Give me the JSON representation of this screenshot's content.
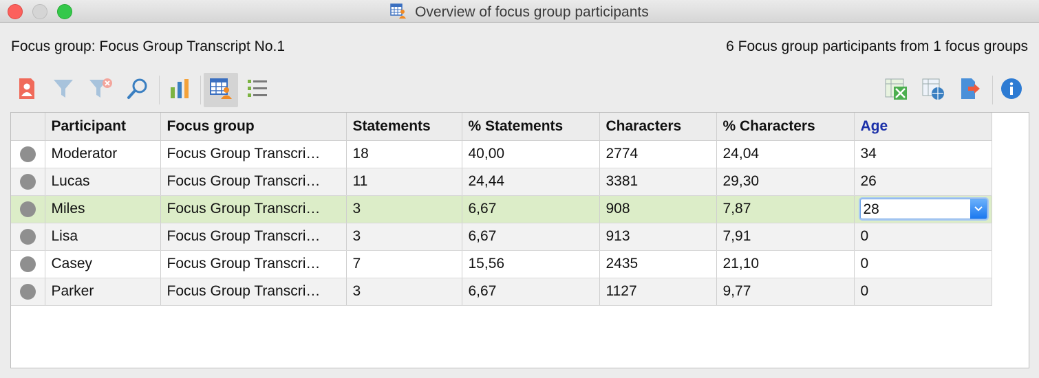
{
  "window": {
    "title": "Overview of focus group participants"
  },
  "info": {
    "focus_group": "Focus group: Focus Group Transcript No.1",
    "summary": "6 Focus group participants from 1 focus groups"
  },
  "toolbar": {
    "icons": [
      "participant-icon",
      "filter-icon",
      "remove-filter-icon",
      "search-icon",
      "bar-chart-icon",
      "participant-table-icon",
      "list-icon",
      "excel-export-icon",
      "html-export-icon",
      "export-icon",
      "info-icon"
    ]
  },
  "table": {
    "columns": [
      "Participant",
      "Focus group",
      "Statements",
      "% Statements",
      "Characters",
      "% Characters",
      "Age"
    ],
    "rows": [
      {
        "participant": "Moderator",
        "group": "Focus Group Transcri…",
        "statements": "18",
        "pct_statements": "40,00",
        "characters": "2774",
        "pct_characters": "24,04",
        "age": "34"
      },
      {
        "participant": "Lucas",
        "group": "Focus Group Transcri…",
        "statements": "11",
        "pct_statements": "24,44",
        "characters": "3381",
        "pct_characters": "29,30",
        "age": "26"
      },
      {
        "participant": "Miles",
        "group": "Focus Group Transcri…",
        "statements": "3",
        "pct_statements": "6,67",
        "characters": "908",
        "pct_characters": "7,87",
        "age": "28"
      },
      {
        "participant": "Lisa",
        "group": "Focus Group Transcri…",
        "statements": "3",
        "pct_statements": "6,67",
        "characters": "913",
        "pct_characters": "7,91",
        "age": "0"
      },
      {
        "participant": "Casey",
        "group": "Focus Group Transcri…",
        "statements": "7",
        "pct_statements": "15,56",
        "characters": "2435",
        "pct_characters": "21,10",
        "age": "0"
      },
      {
        "participant": "Parker",
        "group": "Focus Group Transcri…",
        "statements": "3",
        "pct_statements": "6,67",
        "characters": "1127",
        "pct_characters": "9,77",
        "age": "0"
      }
    ],
    "selected_row": 2,
    "editing_value": "28"
  },
  "colors": {
    "selected_row": "#dcedc8",
    "age_header": "#1a2fa8",
    "status_dot": "#8f8f8f"
  }
}
